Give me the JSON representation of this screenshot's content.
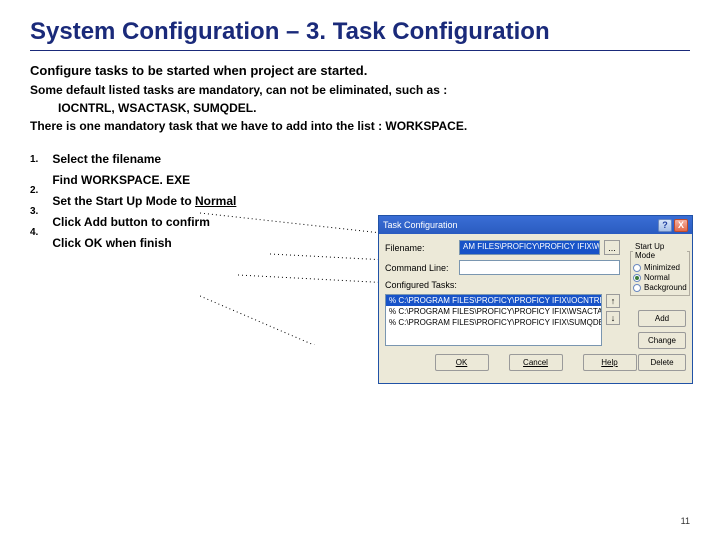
{
  "title": "System Configuration – 3. Task Configuration",
  "subtitle": "Configure tasks to be started when project are started.",
  "body1": "Some default listed tasks are mandatory, can not be eliminated, such as :",
  "body1_indent": "IOCNTRL, WSACTASK, SUMQDEL.",
  "body2": "There is one mandatory task that we have to add into the list : WORKSPACE.",
  "steps": {
    "nums": [
      "1.",
      "2.",
      "3.",
      "4."
    ],
    "s1a": "Select the filename",
    "s1b": "Find WORKSPACE. EXE",
    "s2a": "Set the Start Up Mode to ",
    "s2b": "Normal",
    "s3": "Click Add button to confirm",
    "s4": "Click OK when finish"
  },
  "dialog": {
    "title": "Task Configuration",
    "help": "?",
    "close": "X",
    "filename_label": "Filename:",
    "filename_value": "AM FILES\\PROFICY\\PROFICY IFIX\\WORKSPACE",
    "browse": "...",
    "cmdline_label": "Command Line:",
    "cmdline_value": "",
    "configured_label": "Configured Tasks:",
    "startup": {
      "legend": "Start Up Mode",
      "opt1": "Minimized",
      "opt2": "Normal",
      "opt3": "Background",
      "selected": 2
    },
    "tasks": [
      "% C:\\PROGRAM FILES\\PROFICY\\PROFICY IFIX\\IOCNTRL.EXE",
      "% C:\\PROGRAM FILES\\PROFICY\\PROFICY IFIX\\WSACTASK.EX",
      "% C:\\PROGRAM FILES\\PROFICY\\PROFICY IFIX\\SUMQDEL.EX"
    ],
    "up": "↑",
    "down": "↓",
    "add": "Add",
    "change": "Change",
    "delete": "Delete",
    "ok": "OK",
    "cancel": "Cancel",
    "helpbtn": "Help"
  },
  "page": "11"
}
